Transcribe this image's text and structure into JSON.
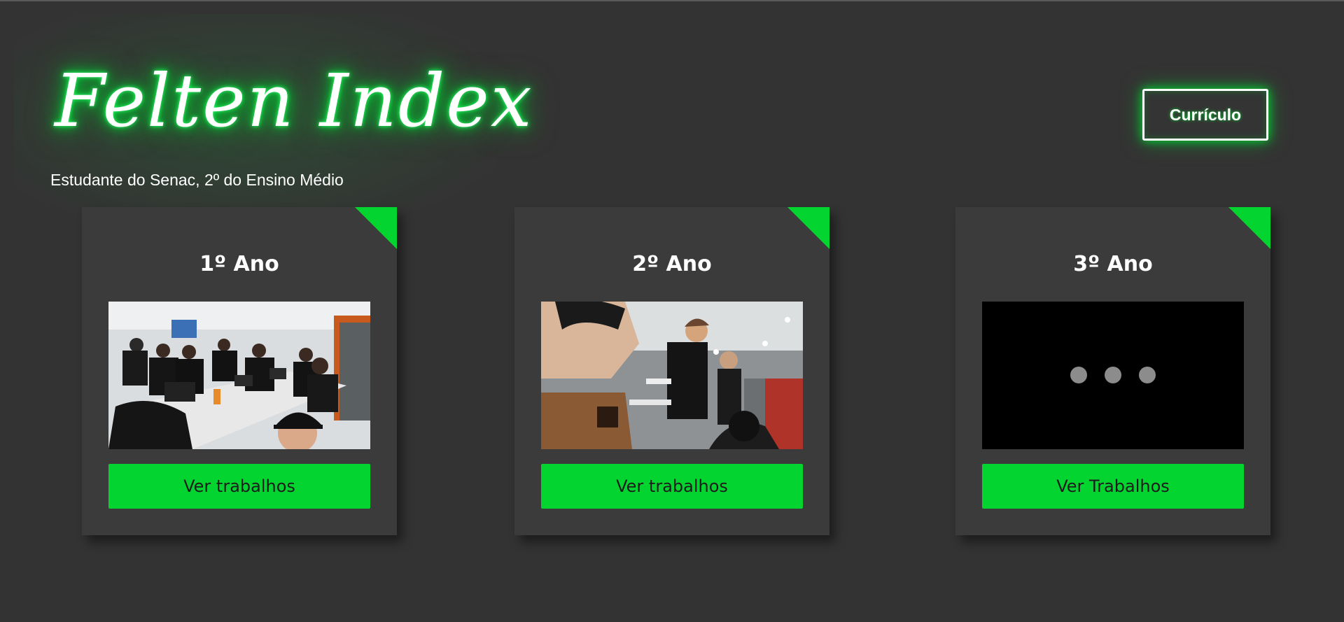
{
  "header": {
    "title": "Felten Index",
    "subtitle": "Estudante do Senac, 2º do Ensino Médio",
    "cv_button_label": "Currículo"
  },
  "cards": [
    {
      "title": "1º Ano",
      "button_label": "Ver trabalhos",
      "media": "photo"
    },
    {
      "title": "2º Ano",
      "button_label": "Ver trabalhos",
      "media": "photo"
    },
    {
      "title": "3º Ano",
      "button_label": "Ver Trabalhos",
      "media": "loading-placeholder"
    }
  ],
  "colors": {
    "background": "#333333",
    "card": "#3b3b3b",
    "accent": "#04d42f",
    "glow": "#00d632",
    "text": "#ffffff"
  },
  "icons": {
    "loading": "loading-dots-icon",
    "corner": "corner-ribbon-icon"
  }
}
